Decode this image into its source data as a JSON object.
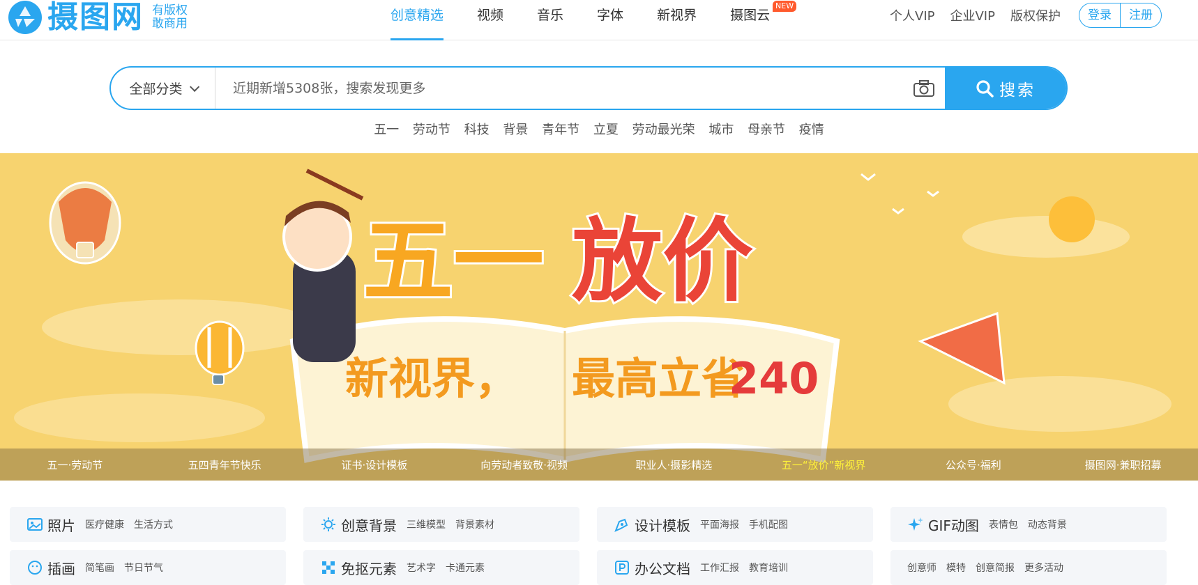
{
  "brand": {
    "name": "摄图网",
    "tag_line1": "有版权",
    "tag_line2": "敢商用"
  },
  "nav": {
    "items": [
      {
        "label": "创意精选",
        "active": true
      },
      {
        "label": "视频"
      },
      {
        "label": "音乐"
      },
      {
        "label": "字体"
      },
      {
        "label": "新视界"
      },
      {
        "label": "摄图云",
        "badge": "NEW"
      }
    ],
    "right": {
      "personal_vip": "个人VIP",
      "enterprise_vip": "企业VIP",
      "copyright": "版权保护",
      "login": "登录",
      "register": "注册"
    }
  },
  "search": {
    "category": "全部分类",
    "placeholder": "近期新增5308张，搜索发现更多",
    "button": "搜索",
    "hot_tags": [
      "五一",
      "劳动节",
      "科技",
      "背景",
      "青年节",
      "立夏",
      "劳动最光荣",
      "城市",
      "母亲节",
      "疫情"
    ]
  },
  "banner": {
    "headline": "五一放价",
    "subline": "新视界，最高立省240",
    "captions": [
      "五一·劳动节",
      "五四青年节快乐",
      "证书·设计模板",
      "向劳动者致敬·视频",
      "职业人·摄影精选",
      "五一“放价”新视界",
      "公众号·福利",
      "摄图网·兼职招募"
    ],
    "active_caption_index": 5
  },
  "categories": [
    {
      "title": "照片",
      "subs": [
        "医疗健康",
        "生活方式"
      ]
    },
    {
      "title": "创意背景",
      "subs": [
        "三维模型",
        "背景素材"
      ]
    },
    {
      "title": "设计模板",
      "subs": [
        "平面海报",
        "手机配图"
      ]
    },
    {
      "title": "GIF动图",
      "subs": [
        "表情包",
        "动态背景"
      ]
    },
    {
      "title": "插画",
      "subs": [
        "简笔画",
        "节日节气"
      ]
    },
    {
      "title": "免抠元素",
      "subs": [
        "艺术字",
        "卡通元素"
      ]
    },
    {
      "title": "办公文档",
      "subs": [
        "工作汇报",
        "教育培训"
      ]
    },
    {
      "title": "",
      "subs": [
        "创意师",
        "模特",
        "创意简报",
        "更多活动"
      ]
    }
  ],
  "colors": {
    "accent": "#2aa6ef",
    "banner_bg": "#f7d36f",
    "badge": "#ff5a2d",
    "active_caption": "#fff23a"
  }
}
